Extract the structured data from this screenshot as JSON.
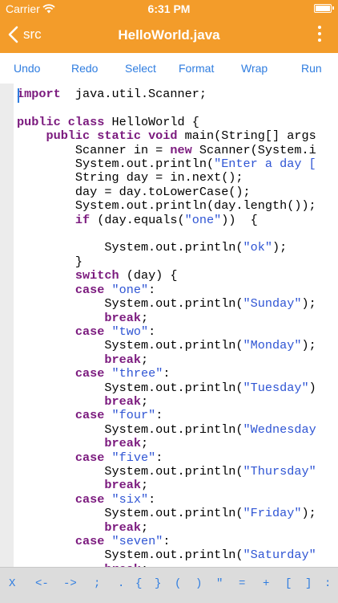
{
  "status": {
    "carrier": "Carrier",
    "time": "6:31 PM"
  },
  "nav": {
    "back_label": "src",
    "title": "HelloWorld.java"
  },
  "toolbar": {
    "undo": "Undo",
    "redo": "Redo",
    "select": "Select",
    "format": "Format",
    "wrap": "Wrap",
    "run": "Run"
  },
  "keys": [
    "X",
    "<-",
    "->",
    ";",
    ".",
    "{",
    "}",
    "(",
    ")",
    "\"",
    "=",
    "+",
    "[",
    "]",
    ":"
  ],
  "colors": {
    "accent": "#f39c2a",
    "toolbar_text": "#2f7de0",
    "keyword": "#7b1a7e",
    "string": "#2f55d4"
  },
  "code": [
    [
      [
        "kw",
        "import"
      ],
      [
        "",
        "  java.util.Scanner;"
      ]
    ],
    [],
    [
      [
        "kw",
        "public class"
      ],
      [
        "",
        " HelloWorld {"
      ]
    ],
    [
      [
        "",
        "    "
      ],
      [
        "kw",
        "public static void"
      ],
      [
        "",
        " main(String[] args"
      ]
    ],
    [
      [
        "",
        "        Scanner in = "
      ],
      [
        "kw",
        "new"
      ],
      [
        "",
        " Scanner(System.i"
      ]
    ],
    [
      [
        "",
        "        System.out.println("
      ],
      [
        "str",
        "\"Enter a day ["
      ]
    ],
    [
      [
        "",
        "        String day = in.next();"
      ]
    ],
    [
      [
        "",
        "        day = day.toLowerCase();"
      ]
    ],
    [
      [
        "",
        "        System.out.println(day.length());"
      ]
    ],
    [
      [
        "",
        "        "
      ],
      [
        "kw",
        "if"
      ],
      [
        "",
        " (day.equals("
      ],
      [
        "str",
        "\"one\""
      ],
      [
        "",
        "))  {"
      ]
    ],
    [],
    [
      [
        "",
        "            System.out.println("
      ],
      [
        "str",
        "\"ok\""
      ],
      [
        "",
        ");"
      ]
    ],
    [
      [
        "",
        "        }"
      ]
    ],
    [
      [
        "",
        "        "
      ],
      [
        "kw",
        "switch"
      ],
      [
        "",
        " (day) {"
      ]
    ],
    [
      [
        "",
        "        "
      ],
      [
        "kw",
        "case"
      ],
      [
        "",
        " "
      ],
      [
        "str",
        "\"one\""
      ],
      [
        "",
        ":"
      ]
    ],
    [
      [
        "",
        "            System.out.println("
      ],
      [
        "str",
        "\"Sunday\""
      ],
      [
        "",
        ");"
      ]
    ],
    [
      [
        "",
        "            "
      ],
      [
        "kw",
        "break"
      ],
      [
        "",
        ";"
      ]
    ],
    [
      [
        "",
        "        "
      ],
      [
        "kw",
        "case"
      ],
      [
        "",
        " "
      ],
      [
        "str",
        "\"two\""
      ],
      [
        "",
        ":"
      ]
    ],
    [
      [
        "",
        "            System.out.println("
      ],
      [
        "str",
        "\"Monday\""
      ],
      [
        "",
        ");"
      ]
    ],
    [
      [
        "",
        "            "
      ],
      [
        "kw",
        "break"
      ],
      [
        "",
        ";"
      ]
    ],
    [
      [
        "",
        "        "
      ],
      [
        "kw",
        "case"
      ],
      [
        "",
        " "
      ],
      [
        "str",
        "\"three\""
      ],
      [
        "",
        ":"
      ]
    ],
    [
      [
        "",
        "            System.out.println("
      ],
      [
        "str",
        "\"Tuesday\""
      ],
      [
        "",
        ")"
      ]
    ],
    [
      [
        "",
        "            "
      ],
      [
        "kw",
        "break"
      ],
      [
        "",
        ";"
      ]
    ],
    [
      [
        "",
        "        "
      ],
      [
        "kw",
        "case"
      ],
      [
        "",
        " "
      ],
      [
        "str",
        "\"four\""
      ],
      [
        "",
        ":"
      ]
    ],
    [
      [
        "",
        "            System.out.println("
      ],
      [
        "str",
        "\"Wednesday"
      ]
    ],
    [
      [
        "",
        "            "
      ],
      [
        "kw",
        "break"
      ],
      [
        "",
        ";"
      ]
    ],
    [
      [
        "",
        "        "
      ],
      [
        "kw",
        "case"
      ],
      [
        "",
        " "
      ],
      [
        "str",
        "\"five\""
      ],
      [
        "",
        ":"
      ]
    ],
    [
      [
        "",
        "            System.out.println("
      ],
      [
        "str",
        "\"Thursday\""
      ]
    ],
    [
      [
        "",
        "            "
      ],
      [
        "kw",
        "break"
      ],
      [
        "",
        ";"
      ]
    ],
    [
      [
        "",
        "        "
      ],
      [
        "kw",
        "case"
      ],
      [
        "",
        " "
      ],
      [
        "str",
        "\"six\""
      ],
      [
        "",
        ":"
      ]
    ],
    [
      [
        "",
        "            System.out.println("
      ],
      [
        "str",
        "\"Friday\""
      ],
      [
        "",
        ");"
      ]
    ],
    [
      [
        "",
        "            "
      ],
      [
        "kw",
        "break"
      ],
      [
        "",
        ";"
      ]
    ],
    [
      [
        "",
        "        "
      ],
      [
        "kw",
        "case"
      ],
      [
        "",
        " "
      ],
      [
        "str",
        "\"seven\""
      ],
      [
        "",
        ":"
      ]
    ],
    [
      [
        "",
        "            System.out.println("
      ],
      [
        "str",
        "\"Saturday\""
      ]
    ],
    [
      [
        "",
        "            "
      ],
      [
        "kw",
        "break"
      ],
      [
        "",
        ";"
      ]
    ]
  ]
}
